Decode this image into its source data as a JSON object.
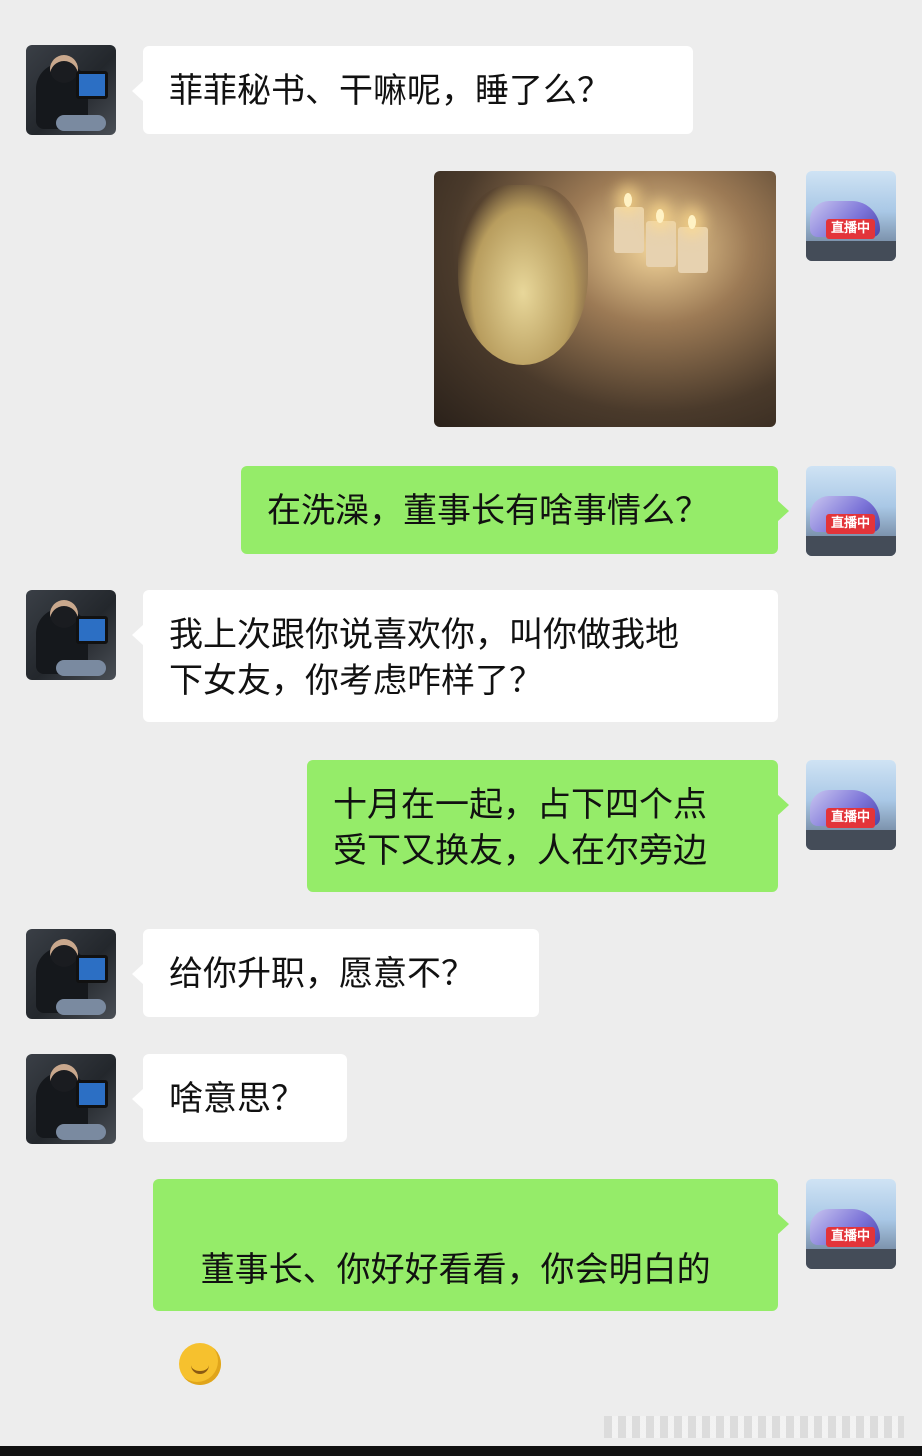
{
  "messages": [
    {
      "side": "left",
      "text": "菲菲秘书、干嘛呢，睡了么？"
    },
    {
      "side": "right",
      "type": "image"
    },
    {
      "side": "right",
      "text": "在洗澡，董事长有啥事情么？"
    },
    {
      "side": "left",
      "text": "我上次跟你说喜欢你，叫你做我地\n下女友，你考虑咋样了？"
    },
    {
      "side": "right",
      "text": "十月在一起，占下四个点\n受下又换友，人在尔旁边"
    },
    {
      "side": "left",
      "text": "给你升职，愿意不？"
    },
    {
      "side": "left",
      "text": "啥意思？"
    },
    {
      "side": "right",
      "text": "董事长、你好好看看，你会明白的"
    }
  ],
  "avatar_right": {
    "live_badge": "直播中"
  },
  "colors": {
    "background": "#ededed",
    "incoming_bubble": "#ffffff",
    "outgoing_bubble": "#95ec69",
    "live_badge": "#e3343a"
  },
  "icons": {
    "emoji": "smirk-emoji-icon"
  }
}
